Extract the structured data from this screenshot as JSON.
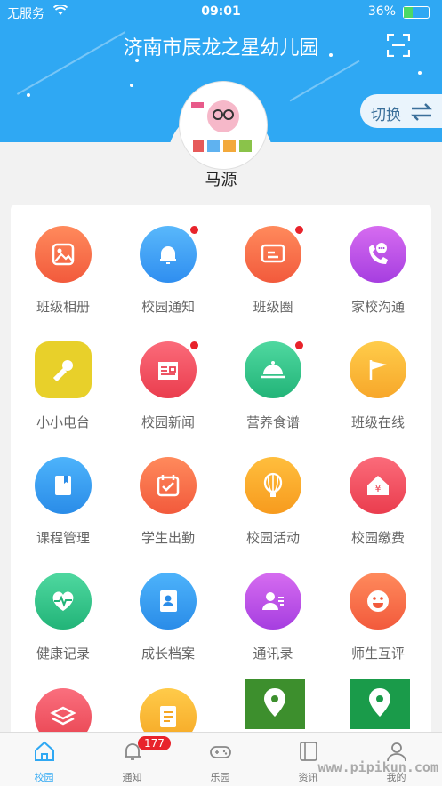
{
  "status": {
    "carrier": "无服务",
    "time": "09:01",
    "battery_pct": "36%",
    "battery_level": 0.36
  },
  "header": {
    "title": "济南市辰龙之星幼儿园",
    "switch_label": "切换"
  },
  "profile": {
    "name": "马源"
  },
  "colors": {
    "header_bg": "#2fa8f3",
    "accent": "#2fa8f3",
    "notify_dot": "#e8232b"
  },
  "grid": [
    {
      "label": "班级相册",
      "icon": "photo-album-icon",
      "dot": false
    },
    {
      "label": "校园通知",
      "icon": "bell-icon",
      "dot": true
    },
    {
      "label": "班级圈",
      "icon": "class-circle-icon",
      "dot": true
    },
    {
      "label": "家校沟通",
      "icon": "chat-phone-icon",
      "dot": false
    },
    {
      "label": "小小电台",
      "icon": "microphone-icon",
      "dot": false
    },
    {
      "label": "校园新闻",
      "icon": "newspaper-icon",
      "dot": true
    },
    {
      "label": "营养食谱",
      "icon": "food-dome-icon",
      "dot": true
    },
    {
      "label": "班级在线",
      "icon": "flag-icon",
      "dot": false
    },
    {
      "label": "课程管理",
      "icon": "book-icon",
      "dot": false
    },
    {
      "label": "学生出勤",
      "icon": "calendar-check-icon",
      "dot": false
    },
    {
      "label": "校园活动",
      "icon": "balloon-icon",
      "dot": false
    },
    {
      "label": "校园缴费",
      "icon": "house-yuan-icon",
      "dot": false
    },
    {
      "label": "健康记录",
      "icon": "heart-pulse-icon",
      "dot": false
    },
    {
      "label": "成长档案",
      "icon": "profile-book-icon",
      "dot": false
    },
    {
      "label": "通讯录",
      "icon": "contacts-icon",
      "dot": false
    },
    {
      "label": "师生互评",
      "icon": "smile-icon",
      "dot": false
    }
  ],
  "tabbar": [
    {
      "label": "校园",
      "icon": "home-icon",
      "active": true
    },
    {
      "label": "通知",
      "icon": "bell-icon",
      "badge": "177"
    },
    {
      "label": "乐园",
      "icon": "gamepad-icon"
    },
    {
      "label": "资讯",
      "icon": "book-icon"
    },
    {
      "label": "我的",
      "icon": "user-icon"
    }
  ],
  "watermark": "www.pipikun.com"
}
